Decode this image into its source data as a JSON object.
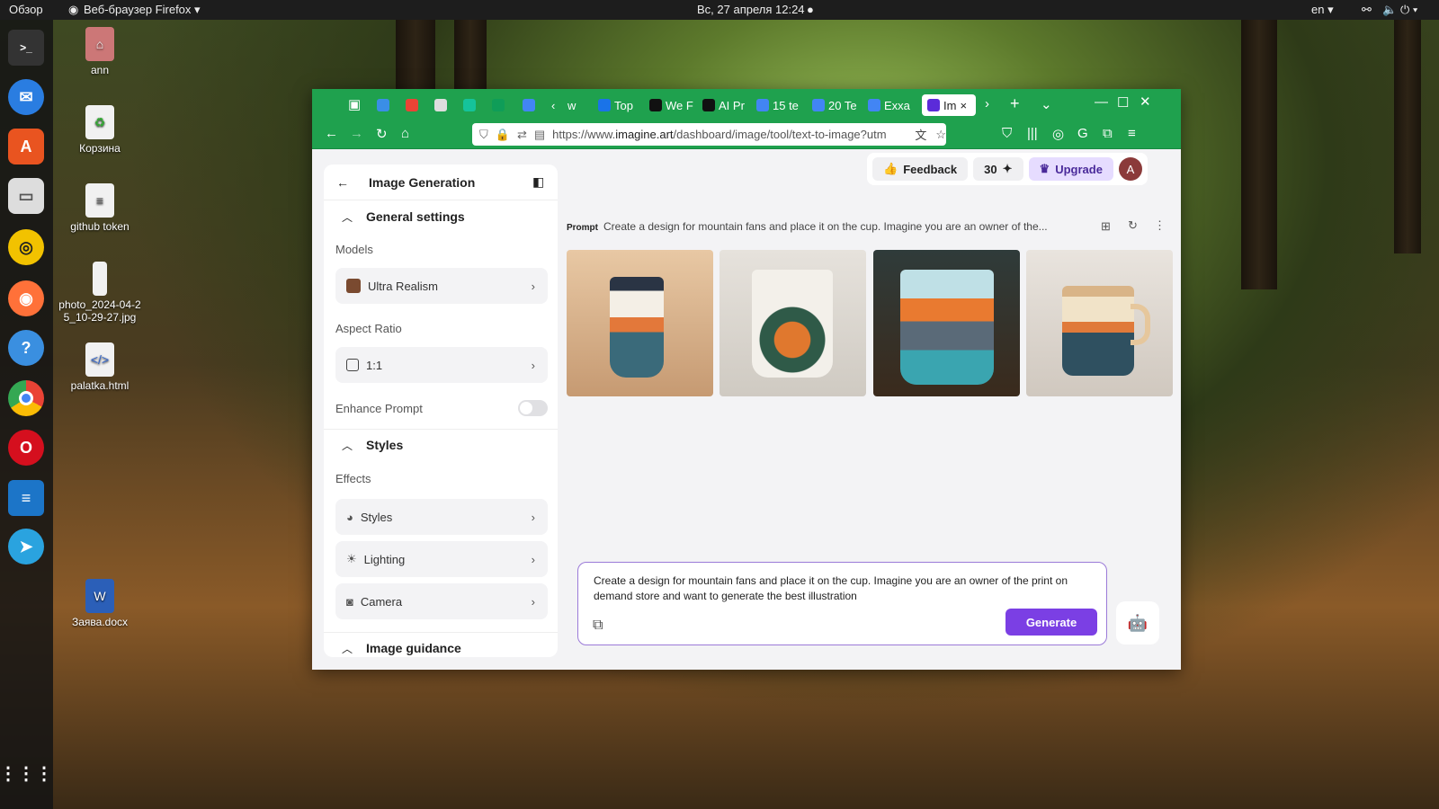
{
  "topbar": {
    "activities": "Обзор",
    "app": "Веб-браузер Firefox",
    "datetime": "Вс, 27 апреля  12:24",
    "lang": "en"
  },
  "desktop": {
    "items": [
      {
        "label": "ann"
      },
      {
        "label": "Корзина"
      },
      {
        "label": "github token"
      },
      {
        "label": "photo_2024-04-25_10-29-27.jpg"
      },
      {
        "label": "palatka.html"
      },
      {
        "label": "Заява.docx"
      }
    ]
  },
  "browser": {
    "tabs": [
      {
        "label": "w"
      },
      {
        "label": "Top"
      },
      {
        "label": "We F"
      },
      {
        "label": "AI Pr"
      },
      {
        "label": "15 te"
      },
      {
        "label": "20 Te"
      },
      {
        "label": "Exxa"
      },
      {
        "label": "Im"
      }
    ],
    "url_prefix": "https://www.",
    "url_domain": "imagine.art",
    "url_suffix": "/dashboard/image/tool/text-to-image?utm"
  },
  "sidebar": {
    "title": "Image Generation",
    "general_title": "General settings",
    "models_label": "Models",
    "model_value": "Ultra Realism",
    "aspect_label": "Aspect Ratio",
    "aspect_value": "1:1",
    "enhance_label": "Enhance Prompt",
    "enhance_on": false,
    "styles_title": "Styles",
    "effects_label": "Effects",
    "effects": [
      {
        "label": "Styles"
      },
      {
        "label": "Lighting"
      },
      {
        "label": "Camera"
      }
    ],
    "guidance_title": "Image guidance"
  },
  "header": {
    "feedback": "Feedback",
    "credits": "30",
    "upgrade": "Upgrade",
    "avatar": "A"
  },
  "prompt": {
    "label": "Prompt",
    "text": "Create a design for mountain fans and place it on the cup. Imagine you are an owner of the..."
  },
  "composer": {
    "text": "Create a design for mountain fans and place it on the cup. Imagine you are an owner of the print on demand store and want to generate the best illustration",
    "generate": "Generate"
  },
  "colors": {
    "browser_chrome": "#1fa14e",
    "accent": "#7b3fe4"
  }
}
